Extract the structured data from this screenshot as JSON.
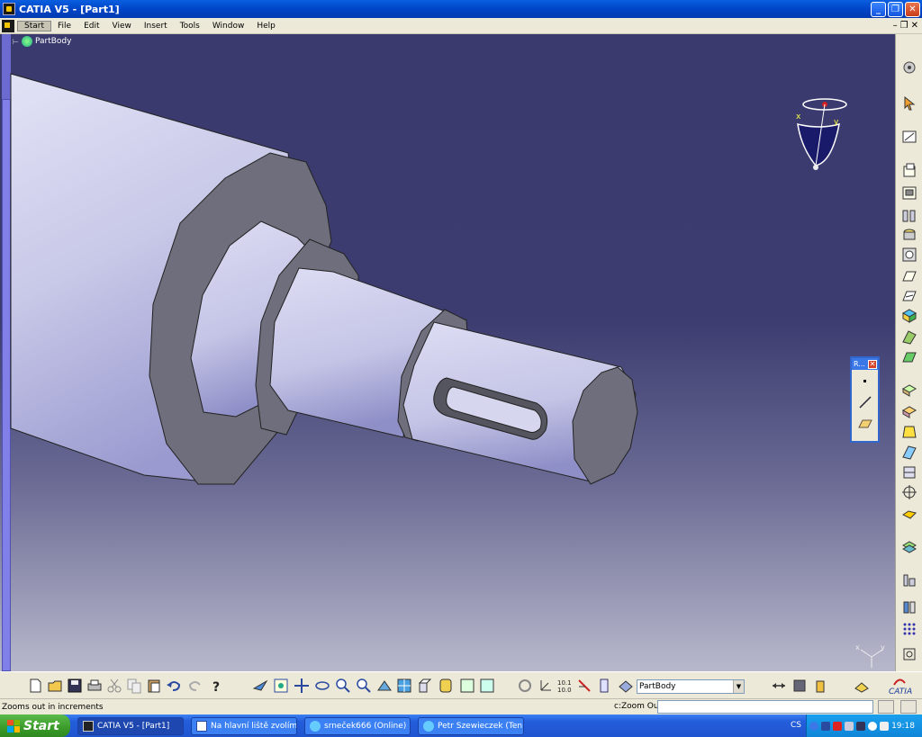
{
  "window": {
    "title": "CATIA V5 - [Part1]"
  },
  "menu": {
    "items": [
      {
        "label": "Start",
        "active": true
      },
      {
        "label": "File"
      },
      {
        "label": "Edit"
      },
      {
        "label": "View"
      },
      {
        "label": "Insert"
      },
      {
        "label": "Tools"
      },
      {
        "label": "Window"
      },
      {
        "label": "Help"
      }
    ]
  },
  "tree": {
    "root": "PartBody"
  },
  "compass": {
    "x_label": "x",
    "y_label": "y"
  },
  "axes": {
    "x_label": "x",
    "y_label": "y"
  },
  "palette": {
    "title": "R..."
  },
  "bottom_toolbar": {
    "current_body": "PartBody"
  },
  "status": {
    "message": "Zooms out in increments",
    "power_input_label": "c:Zoom Out"
  },
  "taskbar": {
    "start_label": "Start",
    "tasks": [
      {
        "label": "CATIA V5 - [Part1]",
        "active": true
      },
      {
        "label": "Na hlavní liště zvolím ..."
      },
      {
        "label": "srneček666 (Online) ..."
      },
      {
        "label": "Petr Szewieczek (Ten..."
      }
    ],
    "language": "CS",
    "clock": "19:18"
  },
  "colors": {
    "viewport_top": "#3a3a6e",
    "viewport_bottom": "#b8b8cc",
    "part_surface": "#d0d0ec",
    "part_face": "#6b6b78"
  }
}
